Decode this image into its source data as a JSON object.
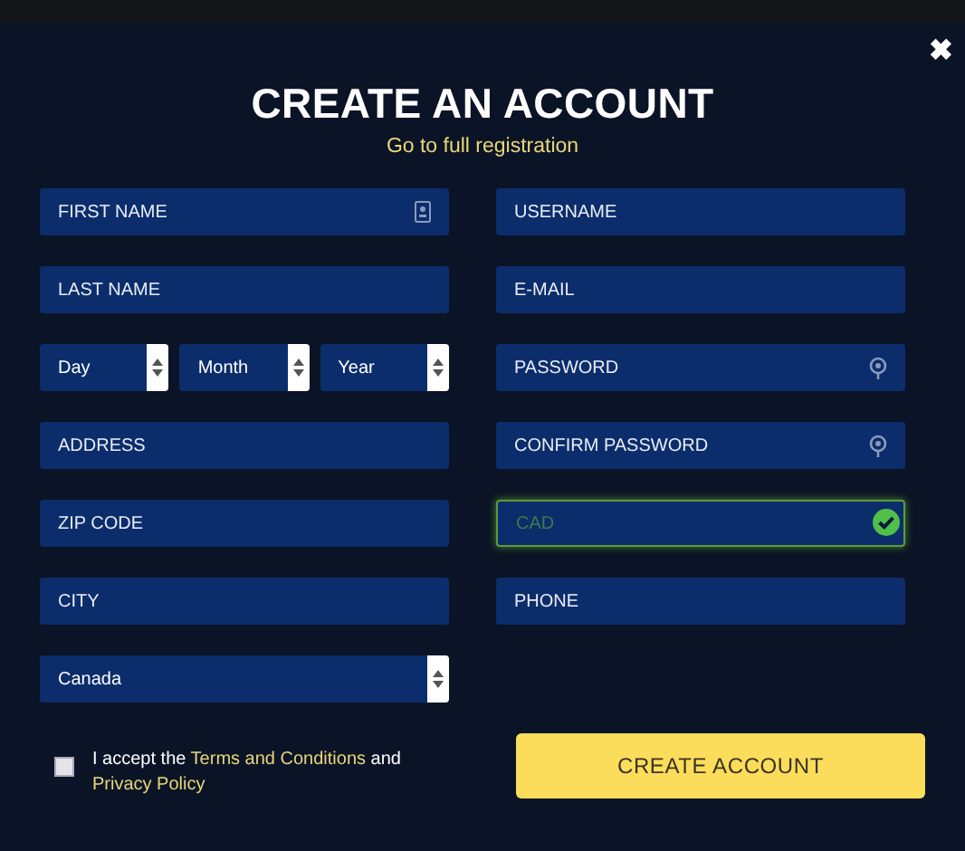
{
  "close": "✖",
  "title": "CREATE AN ACCOUNT",
  "subtitle_link": "Go to full registration",
  "left_fields": [
    {
      "kind": "name",
      "placeholder": "FIRST NAME"
    },
    {
      "kind": "text",
      "placeholder": "LAST NAME"
    },
    {
      "kind": "date",
      "selects": [
        "Day",
        "Month",
        "Year"
      ]
    },
    {
      "kind": "text",
      "placeholder": "ADDRESS"
    },
    {
      "kind": "text",
      "placeholder": "ZIP CODE"
    },
    {
      "kind": "text",
      "placeholder": "CITY"
    },
    {
      "kind": "select",
      "value": "Canada"
    }
  ],
  "right_fields": [
    {
      "kind": "text",
      "placeholder": "USERNAME"
    },
    {
      "kind": "text",
      "placeholder": "E-MAIL"
    },
    {
      "kind": "password",
      "placeholder": "PASSWORD"
    },
    {
      "kind": "password",
      "placeholder": "CONFIRM PASSWORD"
    },
    {
      "kind": "valid",
      "value": "CAD",
      "valid": true
    },
    {
      "kind": "text",
      "placeholder": "PHONE"
    }
  ],
  "terms": {
    "checked": false,
    "text": "I accept the ",
    "link_1": "Terms and Conditions",
    "middle": " and ",
    "link_2": "Privacy Policy"
  },
  "submit": "CREATE ACCOUNT"
}
